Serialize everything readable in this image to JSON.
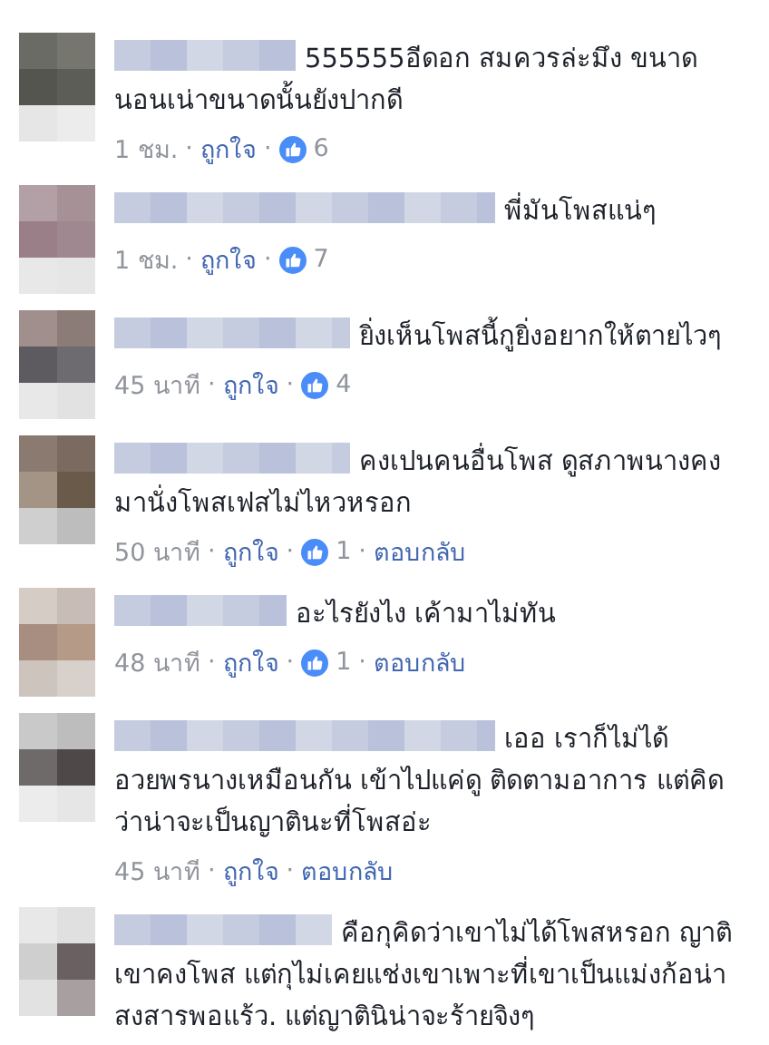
{
  "comments": [
    {
      "text": "555555อีดอก สมควรล่ะมึง ขนาดนอนเน่าขนาดนั้นยังปากดี",
      "meta": [
        {
          "kind": "time",
          "text": "1 ชม."
        },
        {
          "kind": "sep",
          "text": "·"
        },
        {
          "kind": "like",
          "text": "ถูกใจ"
        },
        {
          "kind": "sep",
          "text": "·"
        },
        {
          "kind": "count",
          "text": "6"
        }
      ]
    },
    {
      "text": "พี่มันโพสแน่ๆ",
      "meta": [
        {
          "kind": "time",
          "text": "1 ชม."
        },
        {
          "kind": "sep",
          "text": "·"
        },
        {
          "kind": "like",
          "text": "ถูกใจ"
        },
        {
          "kind": "sep",
          "text": "·"
        },
        {
          "kind": "count",
          "text": "7"
        }
      ]
    },
    {
      "text": "ยิ่งเห็นโพสนี้กูยิ่งอยากให้ตายไวๆ",
      "meta": [
        {
          "kind": "time",
          "text": "45 นาที"
        },
        {
          "kind": "sep",
          "text": "·"
        },
        {
          "kind": "like",
          "text": "ถูกใจ"
        },
        {
          "kind": "sep",
          "text": "·"
        },
        {
          "kind": "count",
          "text": "4"
        }
      ]
    },
    {
      "text": "คงเปนคนอื่นโพส ดูสภาพนางคงมานั่งโพสเฟสไม่ไหวหรอก",
      "meta": [
        {
          "kind": "time",
          "text": "50 นาที"
        },
        {
          "kind": "sep",
          "text": "·"
        },
        {
          "kind": "like",
          "text": "ถูกใจ"
        },
        {
          "kind": "sep",
          "text": "·"
        },
        {
          "kind": "count",
          "text": "1"
        },
        {
          "kind": "sep",
          "text": "·"
        },
        {
          "kind": "reply",
          "text": "ตอบกลับ"
        }
      ]
    },
    {
      "text": "อะไรยังไง เค้ามาไม่ทัน",
      "meta": [
        {
          "kind": "time",
          "text": "48 นาที"
        },
        {
          "kind": "sep",
          "text": "·"
        },
        {
          "kind": "like",
          "text": "ถูกใจ"
        },
        {
          "kind": "sep",
          "text": "·"
        },
        {
          "kind": "count",
          "text": "1"
        },
        {
          "kind": "sep",
          "text": "·"
        },
        {
          "kind": "reply",
          "text": "ตอบกลับ"
        }
      ]
    },
    {
      "text": "เออ เราก็ไม่ได้อวยพรนางเหมือนกัน เข้าไปแค่ดู ติดตามอาการ แต่คิดว่าน่าจะเป็นญาตินะที่โพสอ่ะ",
      "meta": [
        {
          "kind": "time",
          "text": "45 นาที"
        },
        {
          "kind": "sep",
          "text": "·"
        },
        {
          "kind": "like",
          "text": "ถูกใจ"
        },
        {
          "kind": "sep",
          "text": "·"
        },
        {
          "kind": "reply",
          "text": "ตอบกลับ"
        }
      ]
    },
    {
      "text": "คือกุคิดว่าเขาไม่ได้โพสหรอก ญาติเขาคงโพส แต่กุไม่เคยแช่งเขาเพาะที่เขาเป็นแม่งก้อน่าสงสารพอแร้ว. แต่ญาตินิน่าจะร้ายจิงๆ"
    }
  ]
}
